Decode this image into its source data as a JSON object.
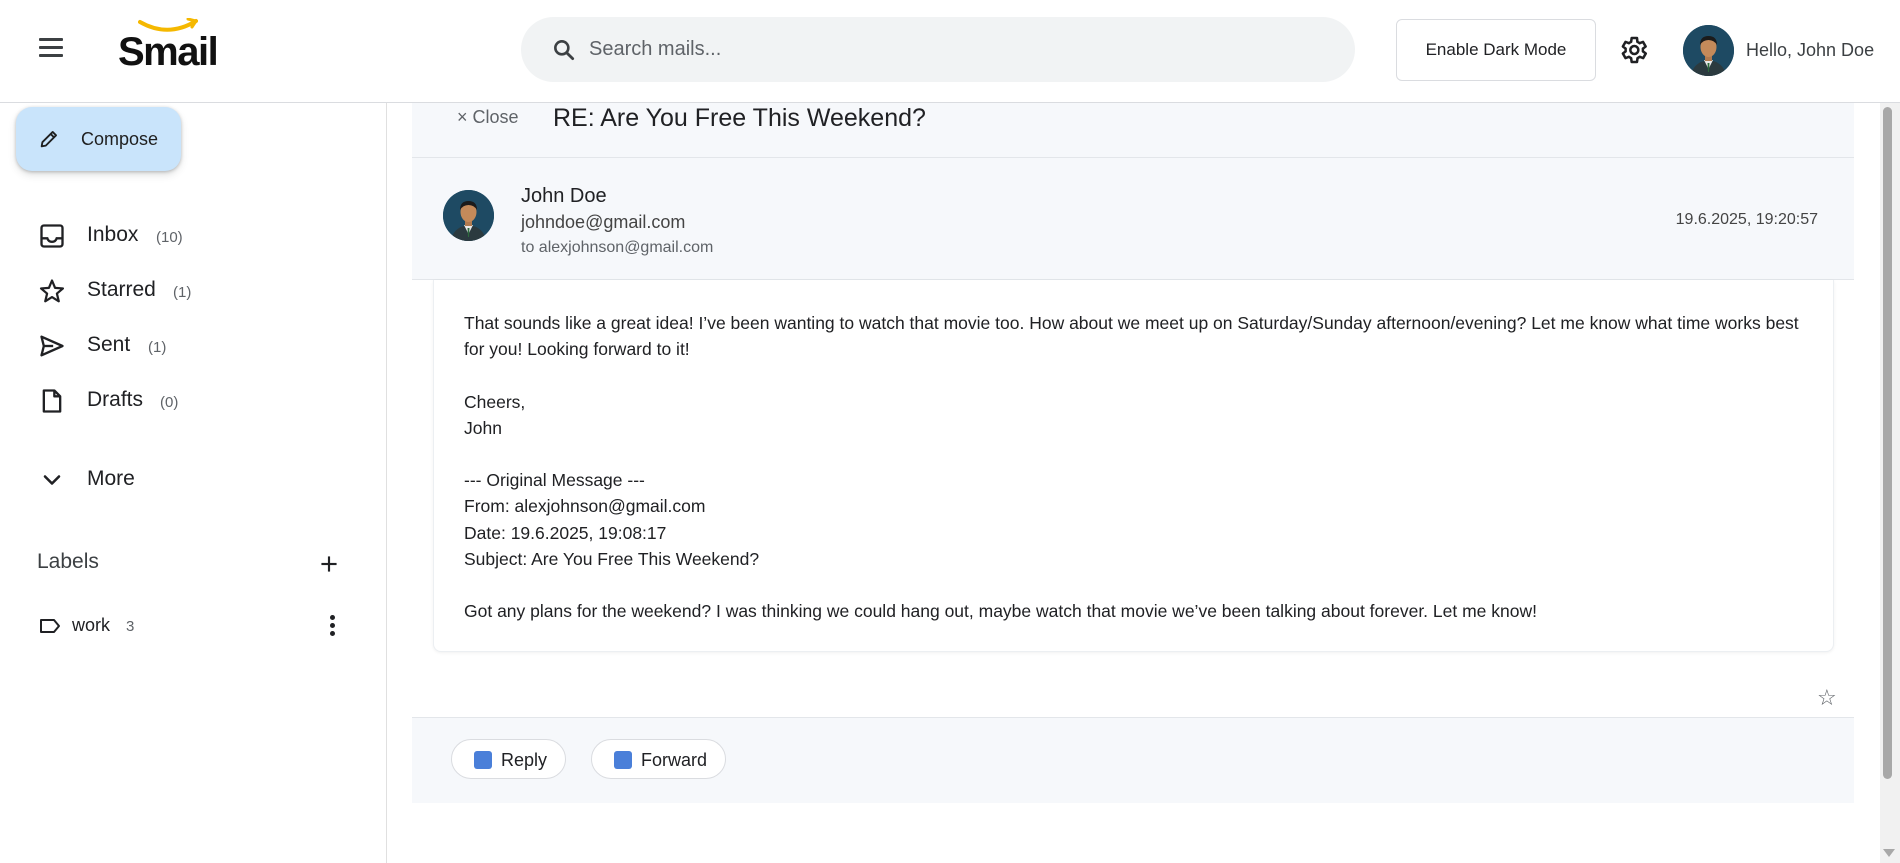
{
  "app": {
    "logo_text": "Smail"
  },
  "header": {
    "search_placeholder": "Search mails...",
    "dark_mode_label": "Enable Dark Mode",
    "greeting": "Hello, John Doe"
  },
  "sidebar": {
    "compose_label": "Compose",
    "folders": [
      {
        "label": "Inbox",
        "count": "(10)",
        "icon": "inbox-icon"
      },
      {
        "label": "Starred",
        "count": "(1)",
        "icon": "star-icon"
      },
      {
        "label": "Sent",
        "count": "(1)",
        "icon": "send-icon"
      },
      {
        "label": "Drafts",
        "count": "(0)",
        "icon": "draft-icon"
      }
    ],
    "more_label": "More",
    "labels_title": "Labels",
    "labels": [
      {
        "name": "work",
        "count": "3"
      }
    ]
  },
  "email": {
    "close_label": "× Close",
    "subject": "RE: Are You Free This Weekend?",
    "sender_name": "John Doe",
    "sender_email": "johndoe@gmail.com",
    "to_line": "to alexjohnson@gmail.com",
    "date": "19.6.2025, 19:20:57",
    "body_lines": [
      "That sounds like a great idea! I’ve been wanting to watch that movie too. How about we meet up on Saturday/Sunday afternoon/evening? Let me know what time works best for you! Looking forward to it!",
      "",
      "Cheers,",
      "John",
      "",
      "--- Original Message ---",
      "From: alexjohnson@gmail.com",
      "Date: 19.6.2025, 19:08:17",
      "Subject: Are You Free This Weekend?",
      "",
      "Got any plans for the weekend? I was thinking we could hang out, maybe watch that movie we’ve been talking about forever. Let me know!"
    ],
    "star_glyph": "☆",
    "reply_label": "Reply",
    "forward_label": "Forward"
  },
  "colors": {
    "accent": "#c9e4fb",
    "logo_smile": "#f5b800",
    "panel_bg": "#f6f8fb"
  }
}
